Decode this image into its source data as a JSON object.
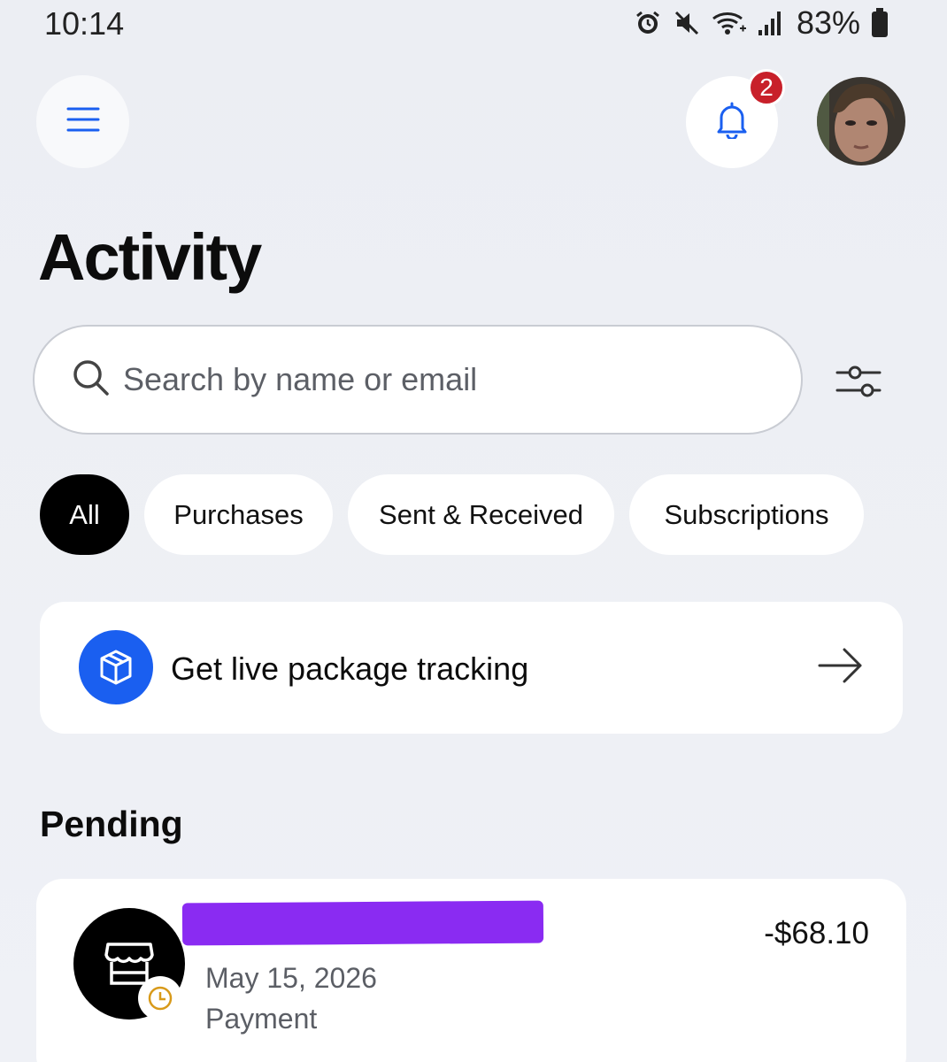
{
  "status_bar": {
    "time": "10:14",
    "battery": "83%",
    "icons": [
      "alarm-icon",
      "mute-icon",
      "wifi-icon",
      "signal-icon",
      "battery-icon"
    ]
  },
  "header": {
    "menu_icon": "hamburger-menu-icon",
    "notifications_icon": "bell-icon",
    "notification_count": "2",
    "avatar": "user-avatar"
  },
  "page": {
    "title": "Activity"
  },
  "search": {
    "placeholder": "Search by name or email",
    "value": ""
  },
  "filters": {
    "icon": "sliders-icon",
    "chips": [
      {
        "label": "All",
        "active": true
      },
      {
        "label": "Purchases",
        "active": false
      },
      {
        "label": "Sent & Received",
        "active": false
      },
      {
        "label": "Subscriptions",
        "active": false
      }
    ]
  },
  "tracking_card": {
    "label": "Get live package tracking",
    "icon": "package-icon"
  },
  "pending": {
    "title": "Pending",
    "transactions": [
      {
        "date": "May 15, 2026",
        "type": "Payment",
        "amount": "-$68.10",
        "icon": "store-icon",
        "status_icon": "clock-icon"
      }
    ]
  },
  "colors": {
    "accent": "#1a5ff0",
    "badge": "#c8202a",
    "redaction": "#8a2bf2",
    "background": "#eef0f5"
  }
}
